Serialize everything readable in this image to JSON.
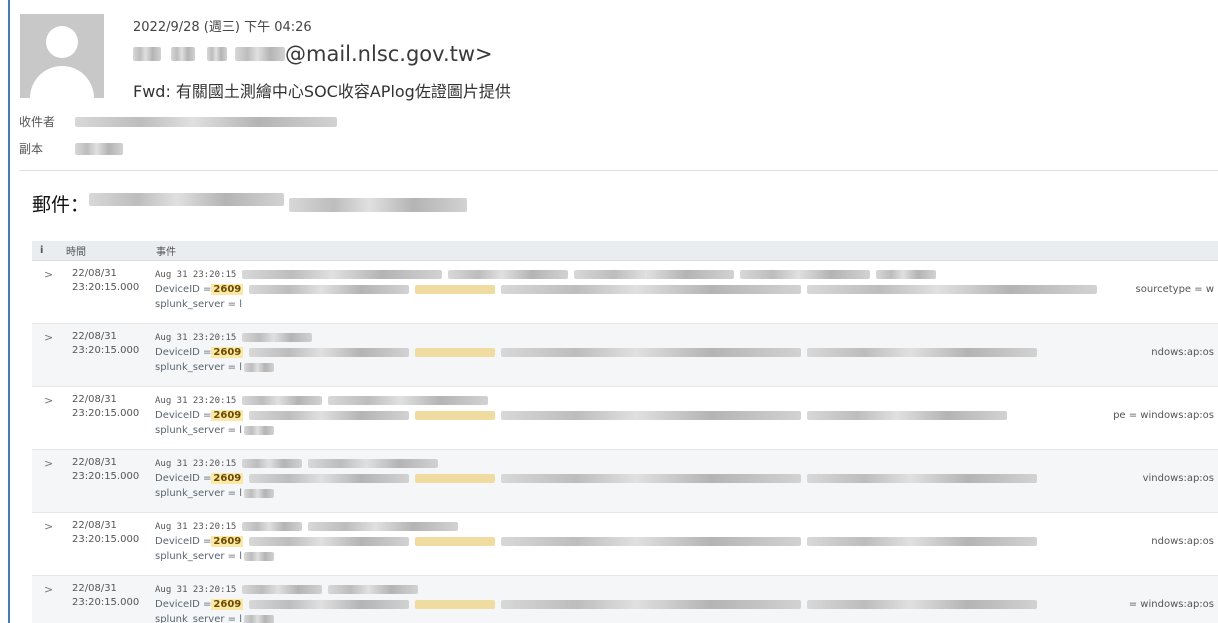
{
  "header": {
    "date": "2022/9/28 (週三) 下午 04:26",
    "from_domain": "@mail.nlsc.gov.tw>",
    "subject": "Fwd: 有關國土測繪中心SOC收容APlog佐證圖片提供"
  },
  "meta": {
    "to_label": "收件者",
    "cc_label": "副本"
  },
  "body": {
    "mail_label": "郵件："
  },
  "table": {
    "headers": {
      "info": "i",
      "time": "時間",
      "event": "事件"
    },
    "rows": [
      {
        "date": "22/08/31",
        "time": "23:20:15.000",
        "raw": "Aug 31 23:20:15",
        "device_field": "DeviceID = ",
        "device_value": "2609",
        "server": "splunk_server = l",
        "tail": "sourcetype = w"
      },
      {
        "date": "22/08/31",
        "time": "23:20:15.000",
        "raw": "Aug 31 23:20:15",
        "device_field": "DeviceID = ",
        "device_value": "2609",
        "server": "splunk_server = l",
        "tail": "ndows:ap:os"
      },
      {
        "date": "22/08/31",
        "time": "23:20:15.000",
        "raw": "Aug 31 23:20:15",
        "device_field": "DeviceID = ",
        "device_value": "2609",
        "server": "splunk_server = l",
        "tail": "pe = windows:ap:os"
      },
      {
        "date": "22/08/31",
        "time": "23:20:15.000",
        "raw": "Aug 31 23:20:15",
        "device_field": "DeviceID = ",
        "device_value": "2609",
        "server": "splunk_server = l",
        "tail": "vindows:ap:os"
      },
      {
        "date": "22/08/31",
        "time": "23:20:15.000",
        "raw": "Aug 31 23:20:15",
        "device_field": "DeviceID = ",
        "device_value": "2609",
        "server": "splunk_server = l",
        "tail": "ndows:ap:os"
      },
      {
        "date": "22/08/31",
        "time": "23:20:15.000",
        "raw": "Aug 31 23:20:15",
        "device_field": "DeviceID = ",
        "device_value": "2609",
        "server": "splunk_server = l",
        "tail": "= windows:ap:os"
      }
    ]
  },
  "icons": {
    "avatar": "person-silhouette-icon",
    "expand": "chevron-right-icon"
  },
  "colors": {
    "highlight": "#fbe8a6",
    "left_rule": "#4a78b0",
    "table_header": "#e9edf0"
  }
}
